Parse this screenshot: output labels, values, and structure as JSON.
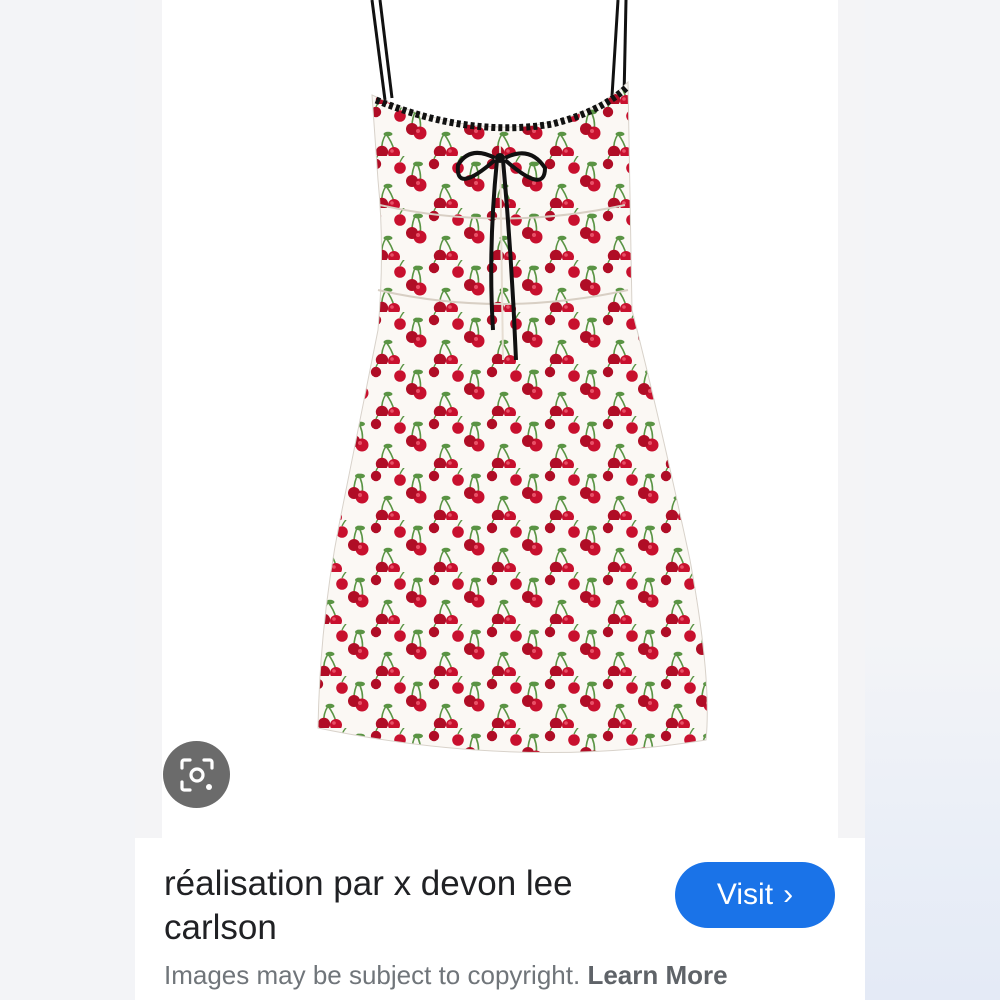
{
  "result": {
    "image_alt": "Cherry print mini slip dress",
    "title": "réalisation par x devon lee carlson",
    "visit_label": "Visit",
    "visit_chevron": "›",
    "copyright_text": "Images may be subject to copyright.",
    "learn_more_label": "Learn More"
  },
  "icons": {
    "lens": "image-search-lens-icon",
    "chevron": "chevron-right-icon"
  },
  "colors": {
    "accent": "#1a73e8",
    "cherry_red": "#c8102e",
    "leaf_green": "#4c8a3a",
    "ribbon_black": "#111111"
  }
}
